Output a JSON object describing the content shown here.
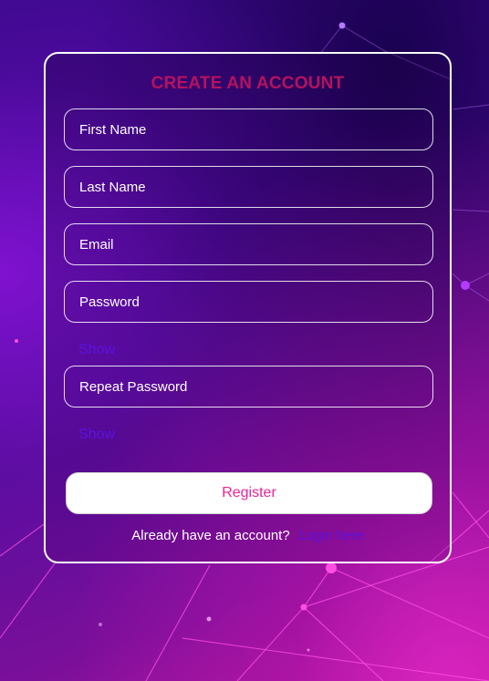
{
  "form": {
    "title": "CREATE AN ACCOUNT",
    "fields": [
      {
        "placeholder": "First Name"
      },
      {
        "placeholder": "Last Name"
      },
      {
        "placeholder": "Email"
      },
      {
        "placeholder": "Password"
      },
      {
        "placeholder": "Repeat Password"
      }
    ],
    "show_password_label": "Show",
    "show_repeat_label": "Show",
    "register_label": "Register",
    "footer_text": "Already have an account?",
    "login_link_label": "Login here"
  },
  "colors": {
    "title": "#b5125f",
    "link": "#5a12e0",
    "register_text": "#e8239a",
    "accent_node": "#ff3fd6"
  }
}
